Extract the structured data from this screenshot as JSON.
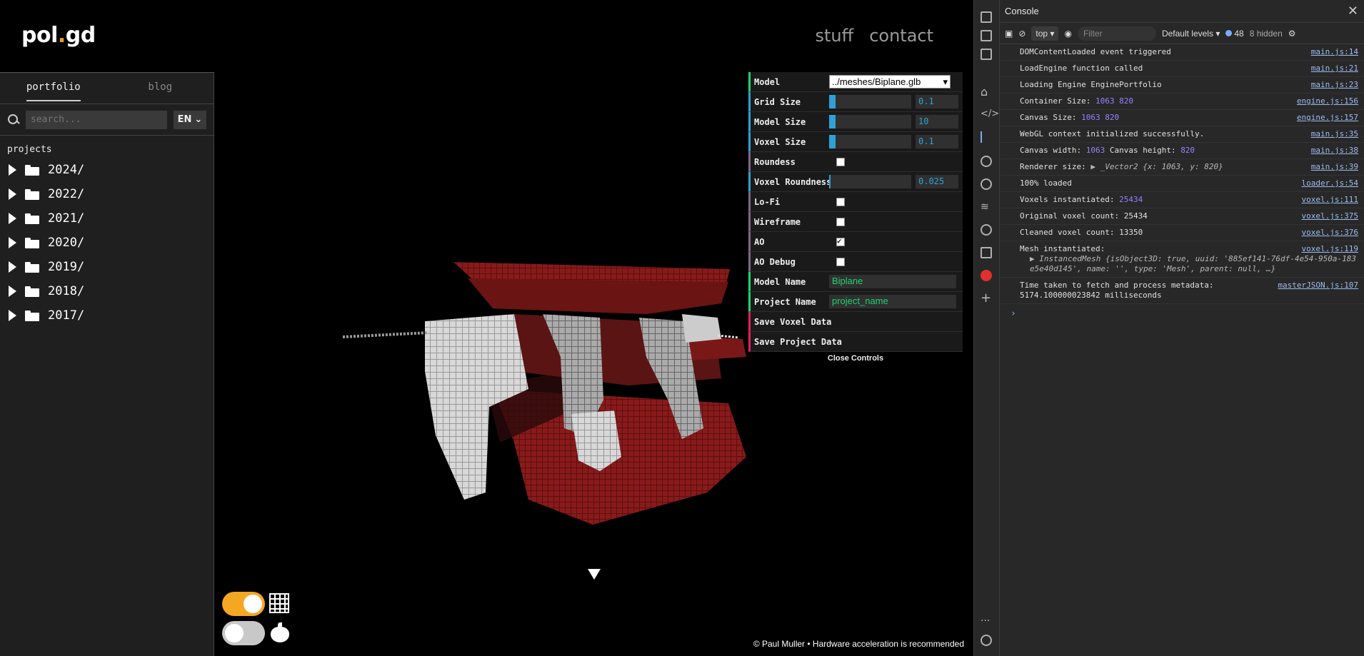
{
  "site": {
    "logo_main": "pol",
    "logo_dot": ".",
    "logo_end": "gd",
    "nav": [
      "stuff",
      "contact"
    ],
    "tabs": [
      "portfolio",
      "blog"
    ],
    "search_placeholder": "search...",
    "language": "EN",
    "tree_title": "projects",
    "folders": [
      "2024/",
      "2022/",
      "2021/",
      "2020/",
      "2019/",
      "2018/",
      "2017/"
    ],
    "footer": "© Paul Muller • Hardware acceleration is recommended"
  },
  "controls": {
    "model_label": "Model",
    "model_value": "../meshes/Biplane.glb",
    "grid_size_label": "Grid Size",
    "grid_size_value": "0.1",
    "grid_size_fraction": 0.08,
    "model_size_label": "Model Size",
    "model_size_value": "10",
    "model_size_fraction": 0.08,
    "voxel_size_label": "Voxel Size",
    "voxel_size_value": "0.1",
    "voxel_size_fraction": 0.08,
    "roundess_label": "Roundess",
    "voxel_roundness_label": "Voxel Roundness",
    "voxel_roundness_value": "0.025",
    "voxel_roundness_fraction": 0.02,
    "lofi_label": "Lo-Fi",
    "wireframe_label": "Wireframe",
    "ao_label": "AO",
    "ao_debug_label": "AO Debug",
    "model_name_label": "Model Name",
    "model_name_value": "Biplane",
    "project_name_label": "Project Name",
    "project_name_value": "project_name",
    "save_voxel_label": "Save Voxel Data",
    "save_project_label": "Save Project Data",
    "close_label": "Close Controls"
  },
  "devtools": {
    "title": "Console",
    "context": "top",
    "filter_placeholder": "Filter",
    "levels": "Default levels",
    "count": "48",
    "hidden": "8 hidden",
    "logs": [
      {
        "text": "DOMContentLoaded event triggered",
        "src": "main.js:14"
      },
      {
        "text": "LoadEngine function called",
        "src": "main.js:21"
      },
      {
        "text": "Loading Engine EnginePortfolio",
        "src": "main.js:23"
      },
      {
        "text": "Container Size:",
        "num": "1063 820",
        "src": "engine.js:156"
      },
      {
        "text": "Canvas Size:",
        "num": "1063 820",
        "src": "engine.js:157"
      },
      {
        "text": "WebGL context initialized successfully.",
        "src": "main.js:35"
      },
      {
        "text": "Canvas width:",
        "num": "1063",
        "text2": "Canvas height:",
        "num2": "820",
        "src": "main.js:38"
      },
      {
        "text": "Renderer size:",
        "obj": "▶ _Vector2 {x: 1063, y: 820}",
        "src": "main.js:39"
      },
      {
        "text": "100% loaded",
        "src": "loader.js:54"
      },
      {
        "text": "Voxels instantiated:",
        "num": "25434",
        "src": "voxel.js:111"
      },
      {
        "text": "Original voxel count: 25434",
        "src": "voxel.js:375"
      },
      {
        "text": "Cleaned voxel count: 13350",
        "src": "voxel.js:376"
      },
      {
        "text": "Mesh instantiated:",
        "src": "voxel.js:119"
      },
      {
        "text": "Time taken to fetch and process metadata:",
        "src": "masterJSON.js:107"
      }
    ],
    "mesh_obj_line1": "InstancedMesh {isObject3D: true, uuid: '885ef141-76df-4e54-950a-183",
    "mesh_obj_line2": "e5e40d145', name: '', type: 'Mesh', parent: null, …}",
    "time_value": "5174.100000023842 milliseconds",
    "prompt": "›"
  },
  "colors": {
    "accent_orange": "#f5a623",
    "slider_blue": "#2fa1d6",
    "text_green": "#1ed36f",
    "button_red": "#e61d5f",
    "voxel_red": "#7a1414"
  }
}
